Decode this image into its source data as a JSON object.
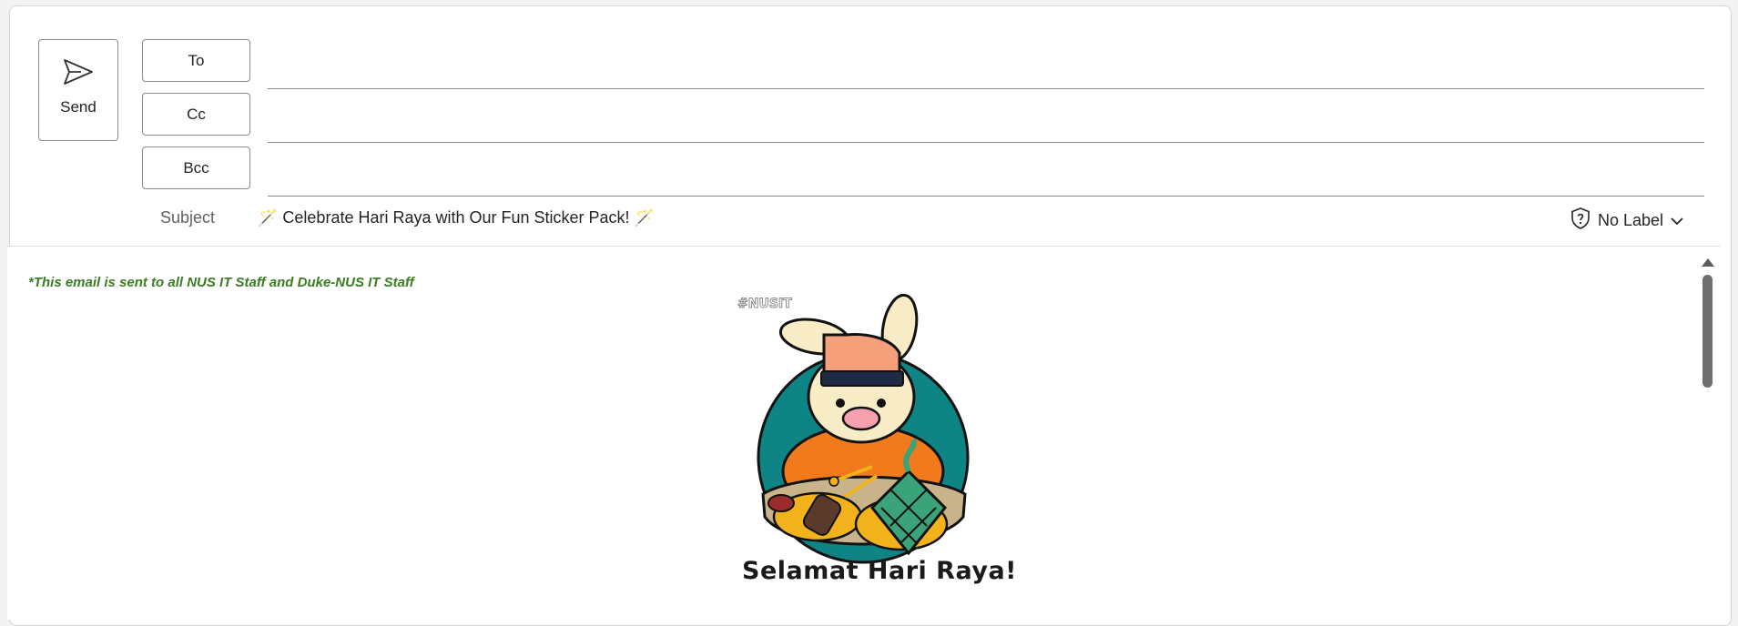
{
  "compose": {
    "send_label": "Send",
    "to_label": "To",
    "cc_label": "Cc",
    "bcc_label": "Bcc",
    "to_value": "",
    "cc_value": "",
    "bcc_value": "",
    "subject_label": "Subject",
    "subject_value": "🪄 Celebrate Hari Raya with Our Fun Sticker Pack! 🪄",
    "sensitivity_label": "No Label"
  },
  "body": {
    "notice": "*This email is sent to all NUS IT Staff and Duke-NUS IT Staff",
    "sticker_tag": "#NUSIT",
    "greeting": "Selamat Hari Raya!"
  },
  "icons": {
    "send": "send-icon",
    "shield": "shield-question-icon",
    "chevron": "chevron-down-icon"
  },
  "colors": {
    "notice_text": "#3a7d22",
    "sticker_teal": "#0f8484",
    "sticker_orange": "#f07a1c"
  }
}
